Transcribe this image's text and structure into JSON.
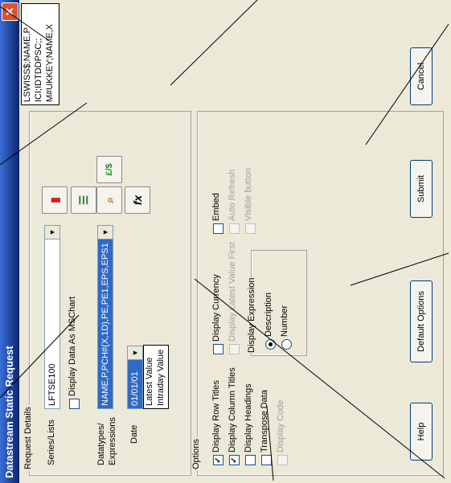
{
  "window": {
    "title": "Datastream Static Request",
    "close_icon": "close-icon"
  },
  "request_details": {
    "group_label": "Request Details",
    "series_label": "Series/Lists",
    "series_value": "LFTSE100",
    "msc_label": "Display Data As MSChart",
    "datatypes_label_1": "Datatypes/",
    "datatypes_label_2": "Expressions",
    "datatypes_value": "NAME,P,PCH#(X,1D),PE,PE1,EPS,EPS1",
    "date_label": "Date",
    "date_value": "01/01/01",
    "date_options": [
      "Latest Value",
      "Intraday Value"
    ]
  },
  "tooltip": {
    "lines": [
      "LSWISS$;NAME,P",
      "ICI;IDTDDPSC;;",
      "M#UKKEY;NAME,X"
    ]
  },
  "options": {
    "group_label": "Options",
    "left": [
      {
        "label": "Display Row Titles",
        "checked": true,
        "disabled": false
      },
      {
        "label": "Display Column Titles",
        "checked": true,
        "disabled": false
      },
      {
        "label": "Display Headings",
        "checked": false,
        "disabled": false
      },
      {
        "label": "Transpose Data",
        "checked": false,
        "disabled": false
      },
      {
        "label": "Display Code",
        "checked": false,
        "disabled": true
      }
    ],
    "middle": [
      {
        "label": "Display Currency",
        "checked": false,
        "disabled": false
      },
      {
        "label": "Display Latest Value First",
        "checked": false,
        "disabled": true
      }
    ],
    "right": [
      {
        "label": "Embed",
        "checked": false,
        "disabled": false
      },
      {
        "label": "Auto Refresh",
        "checked": false,
        "disabled": true
      },
      {
        "label": "Visible button",
        "checked": false,
        "disabled": true
      }
    ],
    "expression_group": "Display Expression",
    "radios": [
      {
        "label": "Description",
        "selected": true
      },
      {
        "label": "Number",
        "selected": false
      }
    ]
  },
  "buttons": {
    "help": "Help",
    "default_options": "Default Options",
    "submit": "Submit",
    "cancel": "Cancel"
  },
  "icons": {
    "series_tool": "red-bookmark-icon",
    "series_tool2": "list-edit-icon",
    "datatypes_tool": "search-datatypes-icon",
    "currency": "currency-icon",
    "function": "function-icon",
    "currency_text": "£/$",
    "function_text": "fx"
  }
}
